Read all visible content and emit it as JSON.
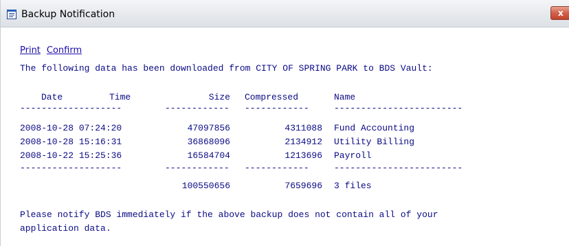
{
  "window": {
    "title": "Backup Notification",
    "close_glyph": "x"
  },
  "icons": {
    "app": "document-icon",
    "close": "close-icon"
  },
  "links": {
    "print": "Print",
    "confirm": "Confirm"
  },
  "message": {
    "intro": "The following data has been downloaded from CITY OF SPRING PARK to BDS Vault:",
    "footer_line1": "Please notify BDS immediately if the above backup does not contain all of your",
    "footer_line2": "application data."
  },
  "table": {
    "headers": {
      "date": "Date",
      "time": "Time",
      "size": "Size",
      "compressed": "Compressed",
      "name": "Name"
    },
    "separator": {
      "datetime": "-------------------",
      "size": "------------",
      "compressed": "------------",
      "name": "------------------------"
    },
    "rows": [
      {
        "datetime": "2008-10-28 07:24:20",
        "size": "47097856",
        "compressed": "4311088",
        "name": "Fund Accounting"
      },
      {
        "datetime": "2008-10-28 15:16:31",
        "size": "36868096",
        "compressed": "2134912",
        "name": "Utility Billing"
      },
      {
        "datetime": "2008-10-22 15:25:36",
        "size": "16584704",
        "compressed": "1213696",
        "name": "Payroll"
      }
    ],
    "totals": {
      "size": "100550656",
      "compressed": "7659696",
      "name": "3 files"
    }
  },
  "colors": {
    "text": "#0a0a85",
    "link": "#1a0dab",
    "close_button": "#c8503a"
  }
}
